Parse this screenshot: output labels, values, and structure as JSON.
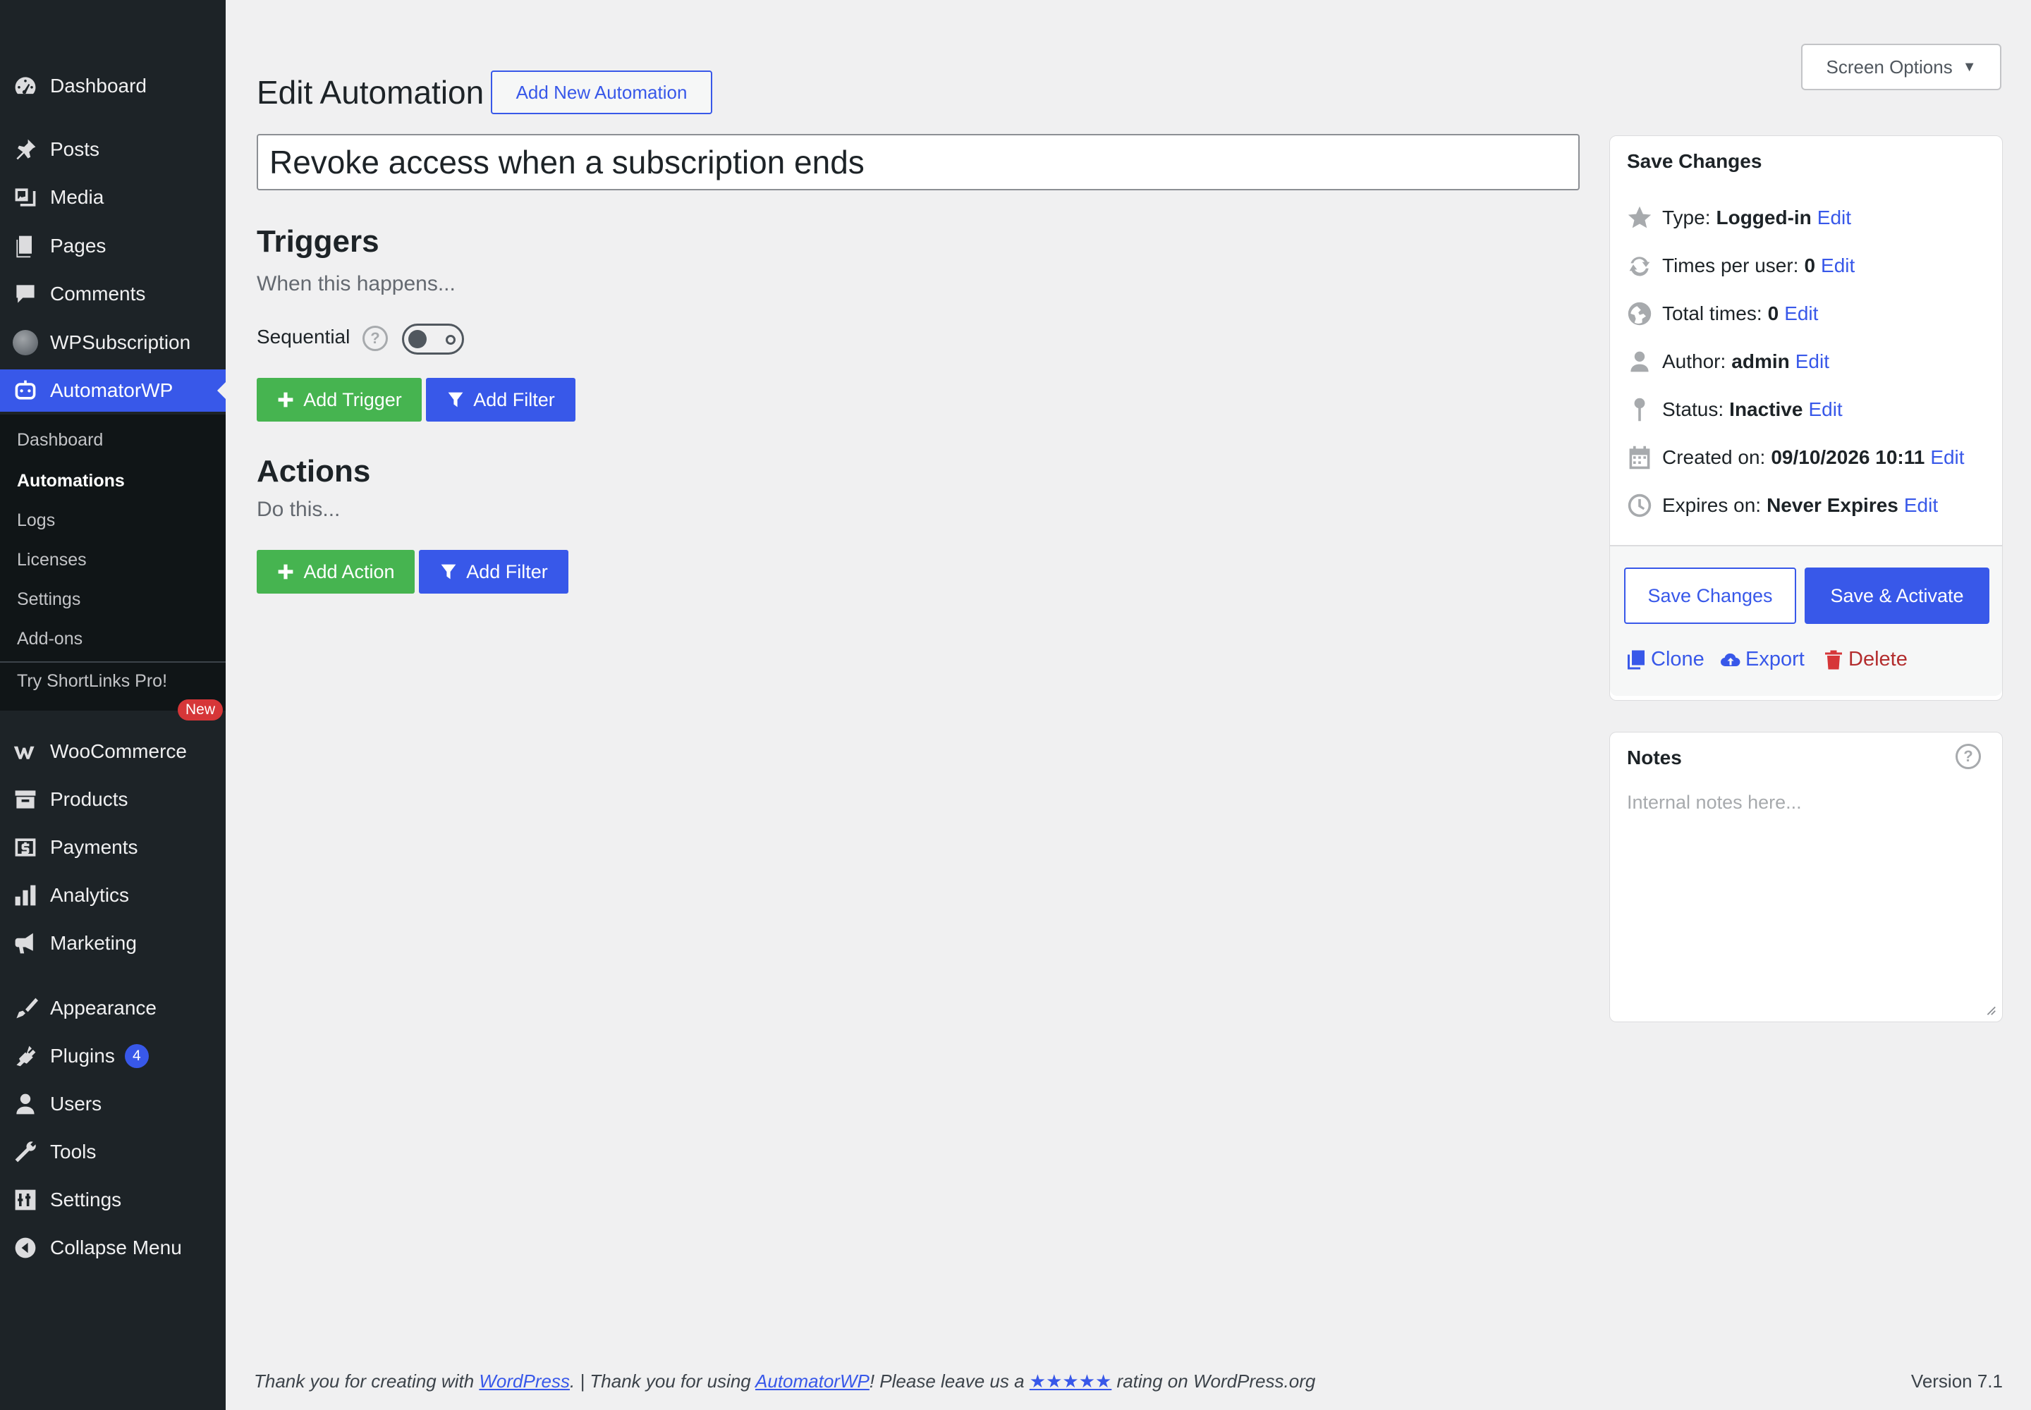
{
  "sidebar": {
    "items": [
      {
        "label": "Dashboard",
        "icon": "dashboard-icon"
      },
      {
        "label": "Posts",
        "icon": "pin-icon"
      },
      {
        "label": "Media",
        "icon": "media-icon"
      },
      {
        "label": "Pages",
        "icon": "pages-icon"
      },
      {
        "label": "Comments",
        "icon": "comment-icon"
      },
      {
        "label": "WPSubscription",
        "icon": "wpsubscription-icon"
      },
      {
        "label": "AutomatorWP",
        "icon": "robot-icon"
      },
      {
        "label": "WooCommerce",
        "icon": "woo-icon"
      },
      {
        "label": "Products",
        "icon": "archive-icon"
      },
      {
        "label": "Payments",
        "icon": "dollar-icon"
      },
      {
        "label": "Analytics",
        "icon": "chart-bar-icon"
      },
      {
        "label": "Marketing",
        "icon": "megaphone-icon"
      },
      {
        "label": "Appearance",
        "icon": "brush-icon"
      },
      {
        "label": "Plugins",
        "icon": "plug-icon",
        "badge": "4"
      },
      {
        "label": "Users",
        "icon": "user-icon"
      },
      {
        "label": "Tools",
        "icon": "wrench-icon"
      },
      {
        "label": "Settings",
        "icon": "sliders-icon"
      },
      {
        "label": "Collapse Menu",
        "icon": "collapse-icon"
      }
    ],
    "submenu": [
      "Dashboard",
      "Automations",
      "Logs",
      "Licenses",
      "Settings",
      "Add-ons",
      "Try ShortLinks Pro!"
    ],
    "new_badge": "New"
  },
  "header": {
    "screen_options": "Screen Options",
    "page_title": "Edit Automation",
    "add_new": "Add New Automation"
  },
  "automation": {
    "title": "Revoke access when a subscription ends"
  },
  "triggers": {
    "heading": "Triggers",
    "subheading": "When this happens...",
    "sequential_label": "Sequential",
    "add_trigger": "Add Trigger",
    "add_filter": "Add Filter"
  },
  "actions": {
    "heading": "Actions",
    "subheading": "Do this...",
    "add_action": "Add Action",
    "add_filter": "Add Filter"
  },
  "save_panel": {
    "title": "Save Changes",
    "type_label": "Type:",
    "type_value": "Logged-in",
    "times_user_label": "Times per user:",
    "times_user_value": "0",
    "total_label": "Total times:",
    "total_value": "0",
    "author_label": "Author:",
    "author_value": "admin",
    "status_label": "Status:",
    "status_value": "Inactive",
    "created_label": "Created on:",
    "created_value": "09/10/2026 10:11",
    "expires_label": "Expires on:",
    "expires_value": "Never Expires",
    "edit": "Edit",
    "save_changes": "Save Changes",
    "save_activate": "Save & Activate",
    "clone": "Clone",
    "export": "Export",
    "delete": "Delete"
  },
  "notes_panel": {
    "title": "Notes",
    "placeholder": "Internal notes here..."
  },
  "footer": {
    "text1": "Thank you for creating with ",
    "link1": "WordPress",
    "text2": ". | Thank you for using ",
    "link2": "AutomatorWP",
    "text3": "! Please leave us a ",
    "stars": "★★★★★",
    "text4": " rating on WordPress.org",
    "version": "Version 7.1"
  },
  "colors": {
    "sidebar_bg": "#1d2327",
    "accent": "#3858e9",
    "green": "#46b450",
    "delete_red": "#b32d2e"
  }
}
